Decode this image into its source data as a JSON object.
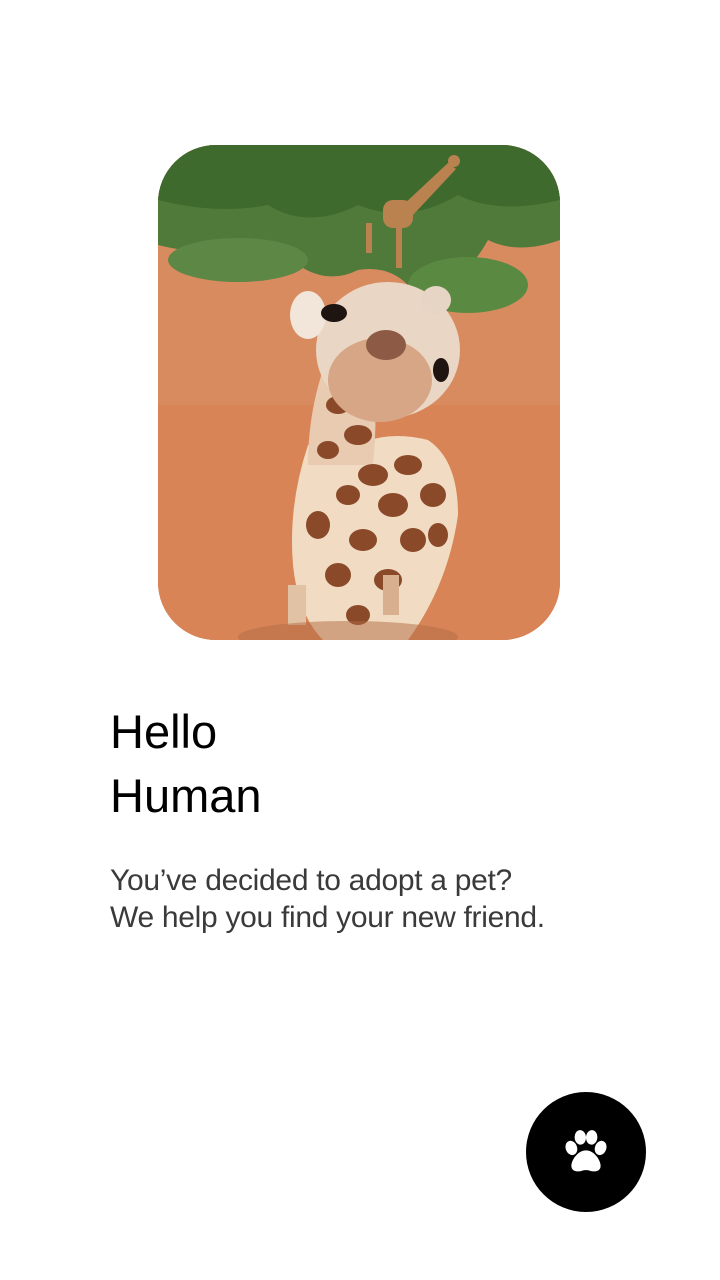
{
  "hero": {
    "image_subject": "giraffe-photo"
  },
  "greeting": {
    "line1": "Hello",
    "line2": "Human"
  },
  "description": {
    "line1": "You’ve decided to adopt a pet?",
    "line2": "We help you find your new friend."
  },
  "fab": {
    "icon": "paw-icon",
    "background": "#000000",
    "icon_color": "#ffffff"
  }
}
